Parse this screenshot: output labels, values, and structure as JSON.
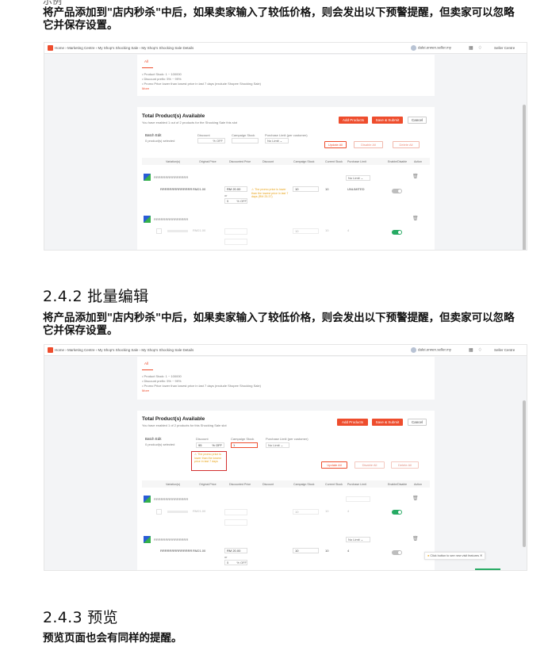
{
  "doc": {
    "cut_top_text": "示例",
    "para1": "将产品添加到\"店内秒杀\"中后，如果卖家输入了较低价格，则会发出以下预警提醒，但卖家可以忽略它并保存设置。",
    "h_batch": "2.4.2 批量编辑",
    "para2": "将产品添加到\"店内秒杀\"中后，如果卖家输入了较低价格，则会发出以下预警提醒，但卖家可以忽略它并保存设置。",
    "h_preview": "2.4.3 预览",
    "para3": "预览页面也会有同样的提醒。"
  },
  "shot1": {
    "breadcrumb": "Home › Marketing Centre › My Shop's Shocking Sale › My Shop's Shocking Sale Details",
    "user": "dalei.erwen.seller.my",
    "center": "Seller Centre",
    "tab": "All",
    "notes": [
      "• Product Stock: 1 ~ 100000",
      "• Discount prefix: 5% ~ 99%",
      "• Promo Price lower than lowest price in last 7 days (exclude Shopee Shocking Sale)",
      "More"
    ],
    "section_title": "Total Product(s) Available",
    "section_sub": "You have enabled 1 out of 2 products for the Shocking Sale this slot",
    "add_products": "Add Products",
    "save_submit": "Save & Submit",
    "cancel": "Cancel",
    "batch_edit": "Batch Edit",
    "batch_selected": "0 product(s) selected",
    "discount_label": "Discount",
    "discount_placeholder": "% OFF",
    "campaign_stock_label": "Campaign Stock",
    "purchase_limit_label": "Purchase Limit (per customer)",
    "no_limit": "No Limit",
    "update_all": "Update All",
    "disable_all": "Disable All",
    "delete_all": "Delete All",
    "headers": [
      "Variation(s)",
      "Original Price",
      "Discounted Price",
      "Discount",
      "Campaign Stock",
      "Current Stock",
      "Purchase Limit",
      "Enable/Disable",
      "Action"
    ],
    "row1_name": "RRRRRRRRRRRRRRR",
    "row1_variation": "RRRRRRRRRRRRRR",
    "row1_orig": "RM21.00",
    "row1_disc": "RM 20.00",
    "row1_or": "or",
    "row1_pct": "5",
    "row1_off": "% OFF",
    "row1_warning": "The promo price is lower than the lowest price in last 7 days (RM 25.37)",
    "row1_stock": "10",
    "row1_current": "10",
    "row1_limit": "No Limit",
    "row1_unlimited": "UNLIMITED",
    "row2_name": "RRRRRRRRRRRRRRR",
    "row2_orig": "RM21.00",
    "row2_stock": "10",
    "row2_limit": "4"
  },
  "shot2": {
    "breadcrumb": "Home › Marketing Centre › My Shop's Shocking Sale › My Shop's Shocking Sale Details",
    "user": "dalei.erwen.seller.my",
    "center": "Seller Centre",
    "tab": "All",
    "notes": [
      "• Product Stock: 1 ~ 100000",
      "• Discount prefix: 5% ~ 99%",
      "• Promo Price lower than lowest price in last 7 days (exclude Shopee Shocking Sale)",
      "More"
    ],
    "section_title": "Total Product(s) Available",
    "section_sub": "You have enabled 1 of 2 products for this Shocking Sale slot",
    "add_products": "Add Products",
    "save_submit": "Save & Submit",
    "cancel": "Cancel",
    "batch_edit": "Batch Edit",
    "batch_selected": "0 product(s) selected",
    "discount_label": "Discount",
    "discount_value": "95",
    "discount_unit": "% OFF",
    "campaign_stock_label": "Campaign Stock",
    "campaign_stock_value": "1",
    "purchase_limit_label": "Purchase Limit (per customer)",
    "no_limit": "No Limit",
    "batch_warning": "The promo price is lower than the lowest price in last 7 days",
    "update_all": "Update All",
    "disable_all": "Disable All",
    "delete_all": "Delete All",
    "headers": [
      "Variation(s)",
      "Original Price",
      "Discounted Price",
      "Discount",
      "Campaign Stock",
      "Current Stock",
      "Purchase Limit",
      "Enable/Disable",
      "Action"
    ],
    "row1_name": "RRRRRRRRRRRRRRR",
    "row1_orig": "RM21.00",
    "row1_stock": "10",
    "row1_limit": "4",
    "row2_name": "RRRRRRRRRRRRRRR",
    "row2_variation": "RRRRRRRRRRRRRR",
    "row2_orig": "RM21.00",
    "row2_disc": "RM 20.00",
    "row2_or": "or",
    "row2_pct": "5",
    "row2_off": "% OFF",
    "row2_stock": "10",
    "row2_current": "10",
    "row2_limit": "4",
    "row2_no_limit": "No Limit",
    "toast": "Click button to see new visit features"
  },
  "colors": {
    "brand": "#ee4d2d",
    "warning": "#e8a317",
    "toggle_on": "#26aa63",
    "highlight_box": "#d32f2f"
  }
}
